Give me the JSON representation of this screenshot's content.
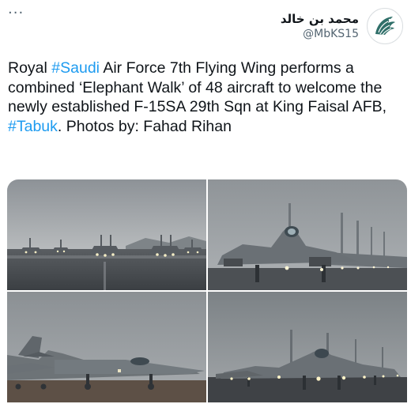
{
  "header": {
    "more_label": "···",
    "display_name": "محمد بن خالد",
    "handle": "@MbKS15",
    "avatar_icon": "eagle-logo-icon"
  },
  "tweet": {
    "segments": [
      {
        "text": "Royal ",
        "type": "text"
      },
      {
        "text": "#Saudi",
        "type": "hashtag"
      },
      {
        "text": " Air Force 7th Flying Wing performs a combined ‘Elephant Walk’ of 48 aircraft to welcome the newly established F-15SA 29th Sqn at King Faisal AFB, ",
        "type": "text"
      },
      {
        "text": "#Tabuk",
        "type": "hashtag"
      },
      {
        "text": ". Photos by: Fahad Rihan",
        "type": "text"
      }
    ]
  },
  "media": {
    "photos": [
      {
        "subject": "distant-formation"
      },
      {
        "subject": "lead-jet-closeup"
      },
      {
        "subject": "side-view-jets"
      },
      {
        "subject": "formation-lights"
      }
    ]
  },
  "colors": {
    "link": "#1d9bf0",
    "secondary_text": "#536471",
    "text": "#0f1419"
  }
}
